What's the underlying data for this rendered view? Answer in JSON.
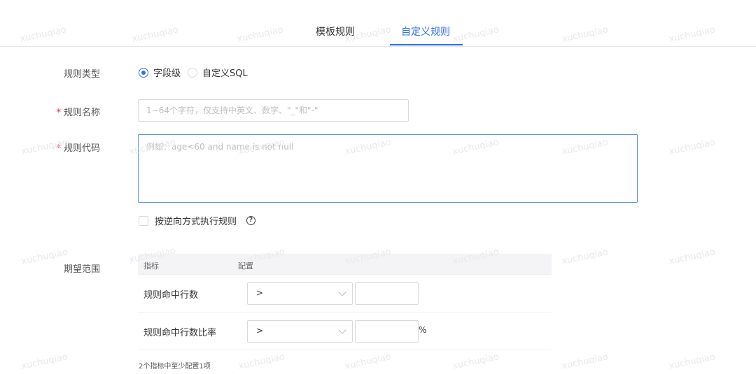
{
  "watermark": "xuchuqiao",
  "tabs": [
    {
      "label": "模板规则",
      "active": false
    },
    {
      "label": "自定义规则",
      "active": true
    }
  ],
  "rule_type": {
    "label": "规则类型",
    "options": [
      {
        "label": "字段级",
        "checked": true
      },
      {
        "label": "自定义SQL",
        "checked": false
      }
    ]
  },
  "rule_name": {
    "label": "规则名称",
    "required_mark": "*",
    "placeholder": "1~64个字符，仅支持中英文、数字、\"_\"和\"-\"",
    "value": ""
  },
  "rule_code": {
    "label": "规则代码",
    "required_mark": "*",
    "placeholder": "例如：age<60 and name is not null",
    "value": ""
  },
  "reverse_check": {
    "label": "按逆向方式执行规则",
    "checked": false,
    "help_icon": "question-circle-icon"
  },
  "expected_range": {
    "label": "期望范围",
    "columns": [
      "指标",
      "配置"
    ],
    "rows": [
      {
        "name": "规则命中行数",
        "operator": ">",
        "value": "",
        "unit": ""
      },
      {
        "name": "规则命中行数比率",
        "operator": ">",
        "value": "",
        "unit": "%"
      }
    ],
    "note": "2个指标中至少配置1项"
  },
  "colors": {
    "accent": "#2f6ef5",
    "required": "#f5222d"
  }
}
